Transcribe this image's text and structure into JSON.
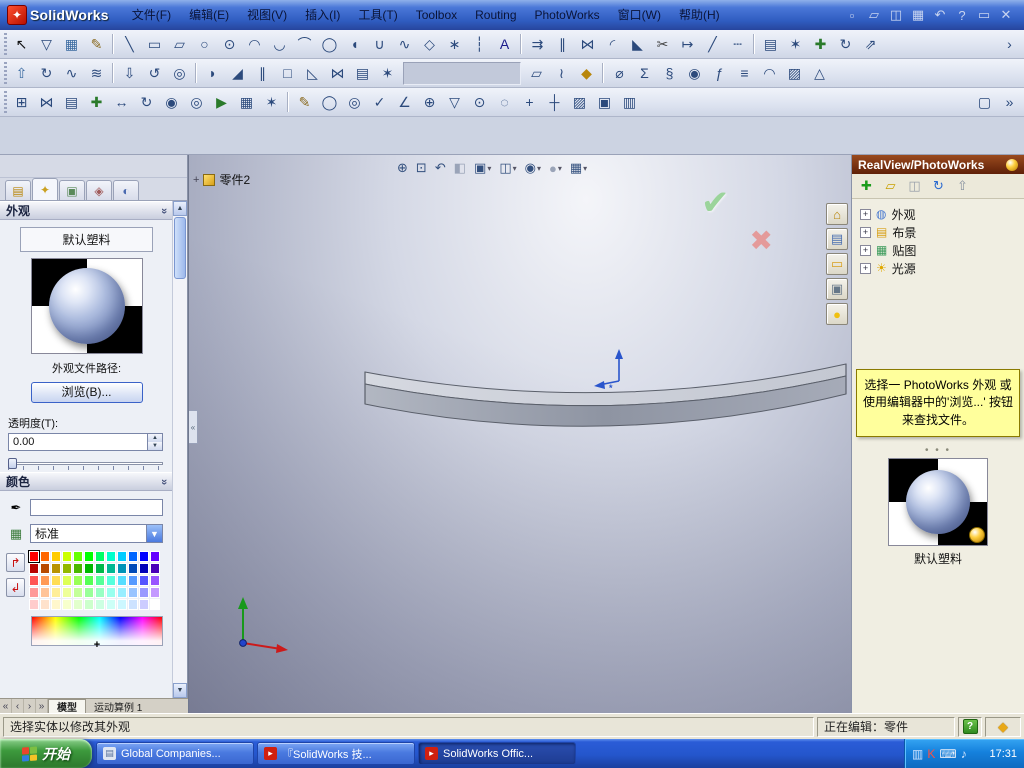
{
  "window": {
    "app_name": "SolidWorks",
    "logo_glyph": "✦"
  },
  "menu": {
    "items": [
      {
        "id": "file",
        "label": "文件(F)"
      },
      {
        "id": "edit",
        "label": "编辑(E)"
      },
      {
        "id": "view",
        "label": "视图(V)"
      },
      {
        "id": "insert",
        "label": "插入(I)"
      },
      {
        "id": "tools",
        "label": "工具(T)"
      },
      {
        "id": "toolbox",
        "label": "Toolbox"
      },
      {
        "id": "routing",
        "label": "Routing"
      },
      {
        "id": "photoworks",
        "label": "PhotoWorks"
      },
      {
        "id": "window",
        "label": "窗口(W)"
      },
      {
        "id": "help",
        "label": "帮助(H)"
      }
    ]
  },
  "titlebar_icons": [
    {
      "name": "new-document-icon",
      "g": "▫"
    },
    {
      "name": "open-icon",
      "g": "▱"
    },
    {
      "name": "save-icon",
      "g": "◫"
    },
    {
      "name": "print-icon",
      "g": "▦"
    },
    {
      "name": "undo-icon",
      "g": "↶"
    },
    {
      "name": "help-icon",
      "g": "?"
    },
    {
      "name": "restore-window-icon",
      "g": "▭"
    },
    {
      "name": "close-icon",
      "g": "✕"
    }
  ],
  "toolbars": {
    "row1": [
      {
        "grip": true
      },
      {
        "name": "select-arrow-icon",
        "g": "↖",
        "c": "#111111"
      },
      {
        "name": "selection-filter-icon",
        "g": "▽"
      },
      {
        "name": "grid-icon",
        "g": "▦",
        "c": "#3a6aa0"
      },
      {
        "name": "sketch-icon",
        "g": "✎",
        "c": "#8a6a20"
      },
      {
        "sep": true
      },
      {
        "name": "line-icon",
        "g": "╲"
      },
      {
        "name": "rectangle-icon",
        "g": "▭"
      },
      {
        "name": "parallelogram-icon",
        "g": "▱"
      },
      {
        "name": "circle-icon",
        "g": "○"
      },
      {
        "name": "perimeter-circle-icon",
        "g": "⊙"
      },
      {
        "name": "centerpoint-arc-icon",
        "g": "◠"
      },
      {
        "name": "tangent-arc-icon",
        "g": "◡"
      },
      {
        "name": "three-point-arc-icon",
        "g": "⌒"
      },
      {
        "name": "ellipse-icon",
        "g": "◯"
      },
      {
        "name": "partial-ellipse-icon",
        "g": "◖"
      },
      {
        "name": "parabola-icon",
        "g": "∪"
      },
      {
        "name": "spline-icon",
        "g": "∿"
      },
      {
        "name": "polygon-icon",
        "g": "◇"
      },
      {
        "name": "point-icon",
        "g": "∗"
      },
      {
        "name": "centerline-icon",
        "g": "┆"
      },
      {
        "name": "text-tool-icon",
        "g": "A",
        "c": "#1a1a8a"
      },
      {
        "sep": true
      },
      {
        "name": "convert-entities-icon",
        "g": "⇉"
      },
      {
        "name": "offset-entities-icon",
        "g": "∥"
      },
      {
        "name": "mirror-entities-icon",
        "g": "⋈"
      },
      {
        "name": "sketch-fillet-icon",
        "g": "◜"
      },
      {
        "name": "sketch-chamfer-icon",
        "g": "◣"
      },
      {
        "name": "trim-entities-icon",
        "g": "✂",
        "c": "#444444"
      },
      {
        "name": "extend-entities-icon",
        "g": "↦"
      },
      {
        "name": "split-entities-icon",
        "g": "╱"
      },
      {
        "name": "construction-geometry-icon",
        "g": "┄"
      },
      {
        "sep": true
      },
      {
        "name": "linear-sketch-pattern-icon",
        "g": "▤"
      },
      {
        "name": "circular-sketch-pattern-icon",
        "g": "✶"
      },
      {
        "name": "move-entities-icon",
        "g": "✚",
        "c": "#2a7a2a"
      },
      {
        "name": "rotate-entities-icon",
        "g": "↻"
      },
      {
        "name": "scale-entities-icon",
        "g": "⇗"
      },
      {
        "flex": true
      },
      {
        "name": "toolbar-overflow-icon",
        "g": "›"
      }
    ],
    "row2": [
      {
        "grip": true
      },
      {
        "name": "extruded-boss-icon",
        "g": "⇧",
        "c": "#3a6aa0"
      },
      {
        "name": "revolved-boss-icon",
        "g": "↻"
      },
      {
        "name": "swept-boss-icon",
        "g": "∿"
      },
      {
        "name": "lofted-boss-icon",
        "g": "≋"
      },
      {
        "sep": true
      },
      {
        "name": "extruded-cut-icon",
        "g": "⇩"
      },
      {
        "name": "revolved-cut-icon",
        "g": "↺"
      },
      {
        "name": "hole-wizard-icon",
        "g": "◎"
      },
      {
        "sep": true
      },
      {
        "name": "fillet-icon",
        "g": "◗"
      },
      {
        "name": "chamfer-icon",
        "g": "◢"
      },
      {
        "name": "rib-icon",
        "g": "∥"
      },
      {
        "name": "shell-icon",
        "g": "□"
      },
      {
        "name": "draft-icon",
        "g": "◺"
      },
      {
        "name": "mirror-feature-icon",
        "g": "⋈"
      },
      {
        "name": "linear-pattern-icon",
        "g": "▤"
      },
      {
        "name": "circular-pattern-icon",
        "g": "✶"
      },
      {
        "well": 118
      },
      {
        "name": "reference-geometry-icon",
        "g": "▱"
      },
      {
        "name": "curves-icon",
        "g": "≀"
      },
      {
        "name": "instant3d-icon",
        "g": "◆",
        "c": "#b8860b"
      },
      {
        "sep": true
      },
      {
        "name": "measure-icon",
        "g": "⌀"
      },
      {
        "name": "mass-properties-icon",
        "g": "Σ"
      },
      {
        "name": "section-properties-icon",
        "g": "§"
      },
      {
        "name": "sensor-icon",
        "g": "◉"
      },
      {
        "name": "equations-icon",
        "g": "ƒ"
      },
      {
        "name": "materials-icon",
        "g": "≡"
      },
      {
        "name": "curvature-icon",
        "g": "◠"
      },
      {
        "name": "zebra-stripes-icon",
        "g": "▨"
      },
      {
        "name": "draft-analysis-icon",
        "g": "△"
      },
      {
        "flex": true
      }
    ],
    "row3": [
      {
        "grip": true
      },
      {
        "name": "insert-components-icon",
        "g": "⊞"
      },
      {
        "name": "mate-icon",
        "g": "⋈"
      },
      {
        "name": "linear-component-pattern-icon",
        "g": "▤"
      },
      {
        "name": "smart-fasteners-icon",
        "g": "✚",
        "c": "#2a7a2a"
      },
      {
        "name": "move-component-icon",
        "g": "↔"
      },
      {
        "name": "rotate-component-icon",
        "g": "↻"
      },
      {
        "name": "show-hidden-components-icon",
        "g": "◉"
      },
      {
        "name": "assembly-features-icon",
        "g": "◎"
      },
      {
        "name": "new-motion-study-icon",
        "g": "▶",
        "c": "#2a7a2a"
      },
      {
        "name": "bill-of-materials-icon",
        "g": "▦"
      },
      {
        "name": "exploded-view-icon",
        "g": "✶"
      },
      {
        "sep": true
      },
      {
        "name": "note-icon",
        "g": "✎",
        "c": "#8a6a20"
      },
      {
        "name": "balloon-icon",
        "g": "◯"
      },
      {
        "name": "auto-balloon-icon",
        "g": "◎"
      },
      {
        "name": "surface-finish-icon",
        "g": "✓"
      },
      {
        "name": "weld-symbol-icon",
        "g": "∠"
      },
      {
        "name": "geometric-tolerance-icon",
        "g": "⊕"
      },
      {
        "name": "datum-feature-icon",
        "g": "▽"
      },
      {
        "name": "datum-target-icon",
        "g": "⊙"
      },
      {
        "name": "hole-callout-icon",
        "g": "◌"
      },
      {
        "name": "center-mark-icon",
        "g": "+"
      },
      {
        "name": "centerline-annotation-icon",
        "g": "┼"
      },
      {
        "name": "area-hatch-icon",
        "g": "▨"
      },
      {
        "name": "block-icon",
        "g": "▣"
      },
      {
        "name": "revision-table-icon",
        "g": "▥"
      },
      {
        "flex": true
      },
      {
        "name": "fullscreen-icon",
        "g": "▢"
      },
      {
        "name": "toolbar-overflow-icon",
        "g": "»"
      }
    ]
  },
  "pm": {
    "tabs": [
      {
        "name": "featuremanager-tab",
        "g": "▤",
        "c": "#b8860b"
      },
      {
        "name": "propertymanager-tab",
        "g": "✦",
        "c": "#caa020",
        "active": true
      },
      {
        "name": "configurationmanager-tab",
        "g": "▣",
        "c": "#5a8a5a"
      },
      {
        "name": "dimxpertmanager-tab",
        "g": "◈",
        "c": "#a05a5a"
      },
      {
        "name": "displaymanager-tab",
        "g": "◐",
        "c": "#4a6ab0"
      }
    ],
    "appearance_header": "外观",
    "material_name": "默认塑料",
    "file_path_label": "外观文件路径:",
    "browse_button": "浏览(B)...",
    "transparency_label": "透明度(T):",
    "transparency_value": "0.00",
    "color_header": "颜色",
    "standard_option": "标准",
    "palette": [
      [
        "#ff0000",
        "#ff6600",
        "#ffcc00",
        "#ccff00",
        "#66ff00",
        "#00ff00",
        "#00ff66",
        "#00ffcc",
        "#00ccff",
        "#0066ff",
        "#0000ff",
        "#6600ff"
      ],
      [
        "#b80000",
        "#b84a00",
        "#b89300",
        "#93b800",
        "#4ab800",
        "#00b800",
        "#00b84a",
        "#00b893",
        "#0093b8",
        "#004ab8",
        "#0000b8",
        "#4a00b8"
      ],
      [
        "#ff5555",
        "#ff9955",
        "#ffdd55",
        "#ddff55",
        "#99ff55",
        "#55ff55",
        "#55ff99",
        "#55ffdd",
        "#55ddff",
        "#5599ff",
        "#5555ff",
        "#9955ff"
      ],
      [
        "#ff9999",
        "#ffc499",
        "#ffee99",
        "#eeff99",
        "#c4ff99",
        "#99ff99",
        "#99ffc4",
        "#99ffee",
        "#99eeff",
        "#99c4ff",
        "#9999ff",
        "#c499ff"
      ],
      [
        "#ffcccc",
        "#ffe2cc",
        "#fff7cc",
        "#f7ffcc",
        "#e2ffcc",
        "#ccffcc",
        "#ccffe2",
        "#ccfff7",
        "#ccf7ff",
        "#cce2ff",
        "#ccccff",
        "#ffffff"
      ]
    ],
    "selected_swatch": [
      0,
      0
    ],
    "tab_nav": [
      {
        "name": "first-tab-button",
        "g": "«"
      },
      {
        "name": "prev-tab-button",
        "g": "‹"
      },
      {
        "name": "next-tab-button",
        "g": "›"
      },
      {
        "name": "last-tab-button",
        "g": "»"
      }
    ],
    "model_tab": "模型",
    "motion_tab": "运动算例 1"
  },
  "viewport": {
    "doc_label": "零件2",
    "topbar": [
      {
        "name": "zoom-to-fit-button",
        "g": "⊕"
      },
      {
        "name": "zoom-to-area-button",
        "g": "⊡"
      },
      {
        "name": "previous-view-button",
        "g": "↶"
      },
      {
        "name": "section-view-button",
        "g": "◧",
        "disabled": true
      },
      {
        "name": "view-orientation-button",
        "g": "▣",
        "dropdown": true
      },
      {
        "name": "display-style-button",
        "g": "◫",
        "dropdown": true
      },
      {
        "name": "hide-show-items-button",
        "g": "◉",
        "dropdown": true
      },
      {
        "name": "edit-appearance-button",
        "g": "●",
        "dropdown": true,
        "disabled": true
      },
      {
        "name": "apply-scene-button",
        "g": "▦",
        "dropdown": true
      }
    ],
    "side_tabs": [
      {
        "name": "solidworks-resources-tab",
        "g": "⌂",
        "c": "#b8860b"
      },
      {
        "name": "design-library-tab",
        "g": "▤",
        "c": "#4a6fb0"
      },
      {
        "name": "file-explorer-tab",
        "g": "▭",
        "c": "#d8a020"
      },
      {
        "name": "view-palette-tab",
        "g": "▣",
        "c": "#667788"
      },
      {
        "name": "photoworks-items-tab",
        "g": "●",
        "c": "#f0c010"
      }
    ],
    "confirm_glyph": "✔",
    "cancel_glyph": "✖"
  },
  "task_pane": {
    "title": "RealView/PhotoWorks",
    "toolbar": [
      {
        "name": "add-appearance-button",
        "g": "✚",
        "c": "#1a9c1a"
      },
      {
        "name": "open-appearance-file-button",
        "g": "▱",
        "c": "#c8a000"
      },
      {
        "name": "save-appearance-button",
        "g": "◫",
        "c": "#99a0aa"
      },
      {
        "name": "refresh-preview-button",
        "g": "↻",
        "c": "#2a6ad0"
      },
      {
        "name": "move-up-button",
        "g": "⇧",
        "c": "#8892a0"
      }
    ],
    "tree": [
      {
        "label": "外观",
        "icon": "appearance-icon",
        "g": "◍",
        "c": "#4a7ad0"
      },
      {
        "label": "布景",
        "icon": "scenery-icon",
        "g": "▤",
        "c": "#d8a018"
      },
      {
        "label": "贴图",
        "icon": "decal-icon",
        "g": "▦",
        "c": "#3a9a5a"
      },
      {
        "label": "光源",
        "icon": "light-source-icon",
        "g": "☀",
        "c": "#e0a800"
      }
    ],
    "note": "选择一 PhotoWorks 外观 或使用编辑器中的'浏览...' 按钮来查找文件。",
    "thumb_label": "默认塑料"
  },
  "status": {
    "left": "选择实体以修改其外观",
    "editing": "正在编辑：零件",
    "quick_tip": "?"
  },
  "taskbar": {
    "start_label": "开始",
    "flag_colors": [
      "#e8452c",
      "#7dbf42",
      "#2f7de0",
      "#f5c327"
    ],
    "tasks": [
      {
        "label": "Global Companies...",
        "icon": "document-task-icon",
        "icon_glyph": "▤",
        "icon_bg": "#dfe6f2",
        "icon_color": "#55709a",
        "active": false
      },
      {
        "label": "『SolidWorks 技...",
        "icon": "solidworks-task-icon",
        "icon_glyph": "▸",
        "icon_bg": "#d02010",
        "icon_color": "#ffffff",
        "active": false
      },
      {
        "label": "SolidWorks Offic...",
        "icon": "solidworks-task-icon",
        "icon_glyph": "▸",
        "icon_bg": "#d02010",
        "icon_color": "#ffffff",
        "active": true
      }
    ],
    "tray": [
      {
        "name": "tray-display-icon",
        "g": "▥",
        "c": "#cfe4ff"
      },
      {
        "name": "tray-antivirus-icon",
        "g": "K",
        "c": "#ff5040"
      },
      {
        "name": "tray-ime-icon",
        "g": "⌨",
        "c": "#e8eef8"
      },
      {
        "name": "tray-volume-icon",
        "g": "♪",
        "c": "#d8e8ff"
      }
    ],
    "time": "17:31"
  }
}
